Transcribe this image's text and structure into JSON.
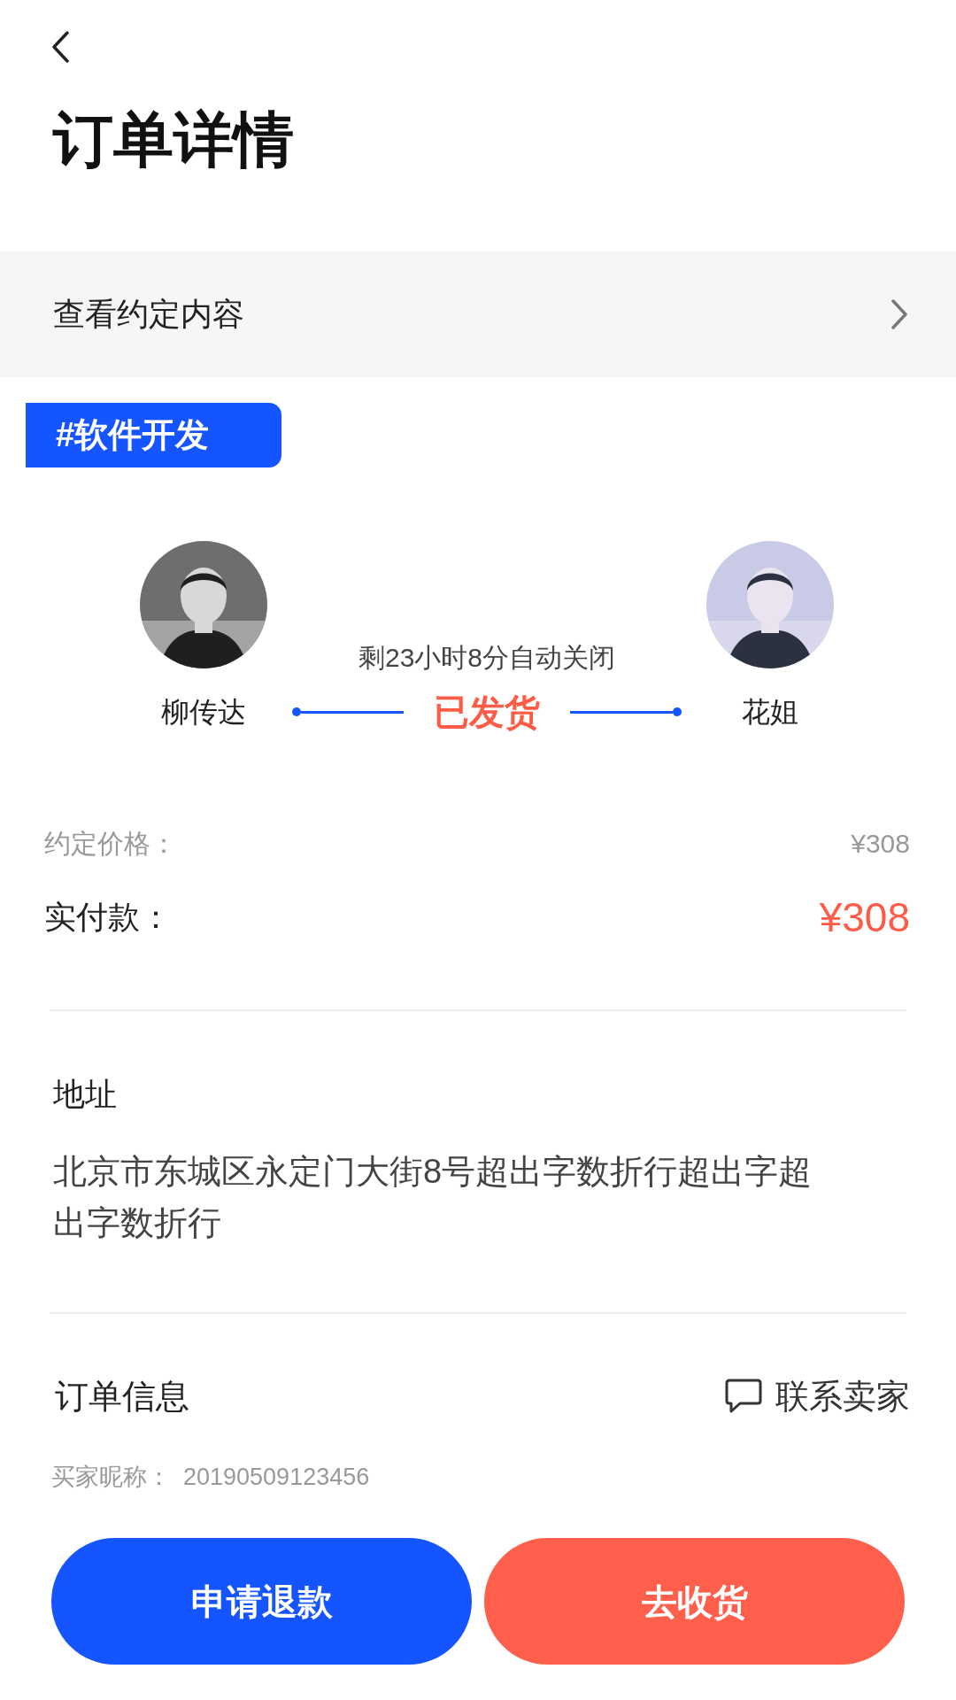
{
  "title": "订单详情",
  "agreement_link": {
    "label": "查看约定内容"
  },
  "tag": "#软件开发",
  "parties": {
    "buyer": {
      "name": "柳传达"
    },
    "seller": {
      "name": "花姐"
    },
    "countdown": "剩23小时8分自动关闭",
    "status": "已发货"
  },
  "prices": [
    {
      "kind": "agreed",
      "label": "约定价格：",
      "value": "¥308"
    },
    {
      "kind": "paid",
      "label": "实付款：",
      "value": "¥308"
    }
  ],
  "address": {
    "heading": "地址",
    "text": "北京市东城区永定门大街8号超出字数折行超出字超出字数折行"
  },
  "order_info": {
    "heading": "订单信息",
    "contact": "联系卖家",
    "fields": [
      {
        "label": "买家昵称：",
        "value": "20190509123456"
      }
    ]
  },
  "buttons": [
    {
      "kind": "secondary",
      "label": "申请退款"
    },
    {
      "kind": "primary",
      "label": "去收货"
    }
  ]
}
